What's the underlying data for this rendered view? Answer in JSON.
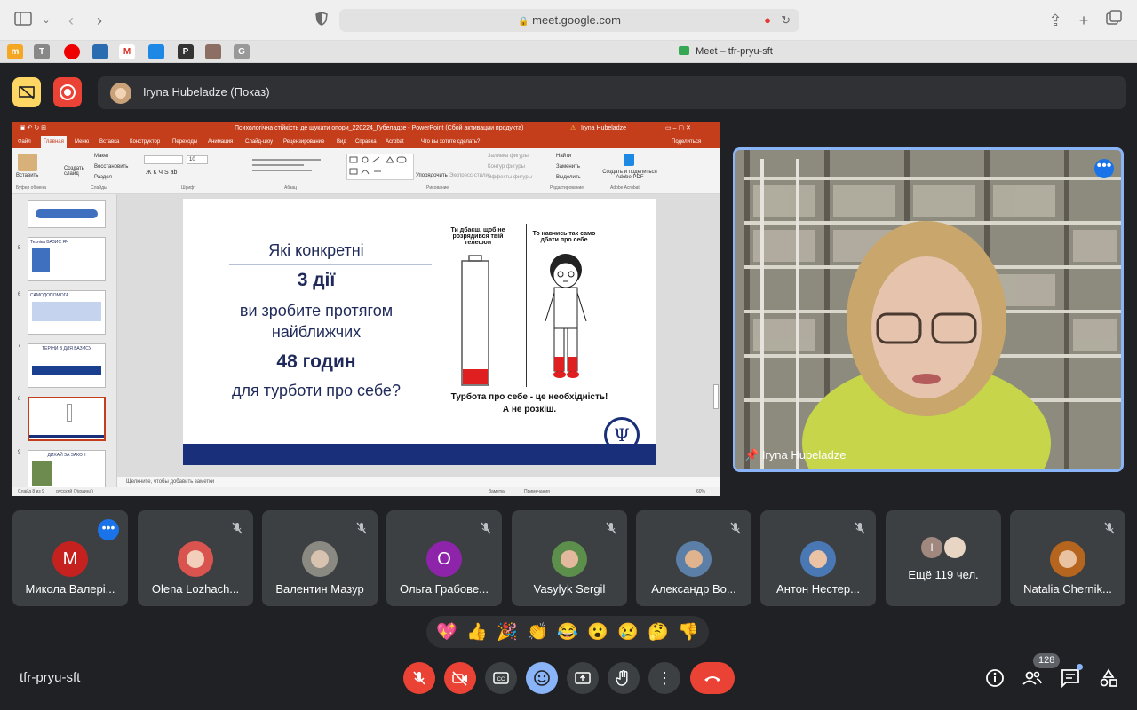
{
  "browser": {
    "url": "meet.google.com",
    "tab_title": "Meet – tfr-pryu-sft",
    "favicons": [
      "m",
      "T",
      "",
      "",
      "M",
      "",
      "P",
      "",
      "G"
    ]
  },
  "presentation_bar": {
    "presenter_label": "Iryna Hubeladze (Показ)"
  },
  "ppt": {
    "window_title": "Психологічна стійкість де шукати опори_220224_Губеладзе - PowerPoint (Сбой активации продукта)",
    "user": "Iryna Hubeladze",
    "share": "Поделиться",
    "tabs": [
      "Файл",
      "Главная",
      "Меню",
      "Вставка",
      "Конструктор",
      "Переходы",
      "Анимация",
      "Слайд-шоу",
      "Рецензирование",
      "Вид",
      "Справка",
      "Acrobat",
      "Что вы хотите сделать?"
    ],
    "ribbon_groups": [
      "Буфер обмена",
      "Слайды",
      "Шрифт",
      "Абзац",
      "Рисование",
      "Редактирование",
      "Adobe Acrobat"
    ],
    "ribbon_items": {
      "paste": "Вставить",
      "new_slide": "Создать слайд",
      "layout": "Макет",
      "restore": "Восстановить",
      "section": "Раздел",
      "arrange": "Упорядочить",
      "quick_styles": "Экспресс-стили",
      "fill": "Заливка фигуры",
      "outline": "Контур фигуры",
      "effects": "Эффекты фигуры",
      "find": "Найти",
      "replace": "Заменить",
      "select": "Выделить",
      "adobe": "Создать и поделиться Adobe PDF",
      "font_size": "10"
    },
    "thumb_numbers": [
      "5",
      "6",
      "7",
      "8",
      "9"
    ],
    "thumb_titles": [
      "Техніка ВАЗИС ЯЧ",
      "САМОДОПОМОГА",
      "ТЕРІНИ В ДЛЯ ВАЗИСУ",
      "",
      "ДИХАЙ ЗА ЗАКОН"
    ],
    "notes_placeholder": "Щелкните, чтобы добавить заметки",
    "status": {
      "slide": "Слайд 8 из 9",
      "lang": "русский (Украина)",
      "notes": "Заметки",
      "comments": "Примечания",
      "zoom": "60%"
    }
  },
  "slide": {
    "line1": "Які конкретні",
    "line2": "3 дії",
    "line3": "ви зробите протягом",
    "line4": "найближчих",
    "line5": "48 годин",
    "line6": "для турботи про себе?",
    "caption_left": "Ти дбаєш, щоб не розрядився твій телефон",
    "caption_right": "То навчись так само дбати про себе",
    "footer_line1": "Турбота про себе  - це необхідність!",
    "footer_line2": "А не розкіш.",
    "battery_level": 0.12
  },
  "speaker": {
    "name": "Iryna Hubeladze"
  },
  "participants": [
    {
      "name": "Микола Валері...",
      "initial": "М",
      "color": "#c5221f",
      "muted": false,
      "more": true
    },
    {
      "name": "Olena Lozhach...",
      "initial": "",
      "color": "#d9534f",
      "muted": true
    },
    {
      "name": "Валентин Мазур",
      "initial": "",
      "color": "#8a8a82",
      "muted": true
    },
    {
      "name": "Ольга Грабове...",
      "initial": "О",
      "color": "#8e24aa",
      "muted": true
    },
    {
      "name": "Vasylyk Sergil",
      "initial": "",
      "color": "#5c8f4c",
      "muted": true
    },
    {
      "name": "Александр Во...",
      "initial": "",
      "color": "#5b7fa6",
      "muted": true
    },
    {
      "name": "Антон Нестер...",
      "initial": "",
      "color": "#4a78b5",
      "muted": true
    },
    {
      "name": "Ещё 119 чел.",
      "initial": "I",
      "color": "#a1887f",
      "muted": false
    },
    {
      "name": "Natalia Chernik...",
      "initial": "",
      "color": "#b5651d",
      "muted": true
    }
  ],
  "reactions": [
    "💖",
    "👍",
    "🎉",
    "👏",
    "😂",
    "😮",
    "😢",
    "🤔",
    "👎"
  ],
  "bottom": {
    "meeting_code": "tfr-pryu-sft",
    "people_count": "128"
  },
  "colors": {
    "meet_bg": "#202124",
    "tile_bg": "#3c4043",
    "danger": "#ea4335",
    "accent": "#8ab4f8",
    "ppt_red": "#c43e1c"
  }
}
